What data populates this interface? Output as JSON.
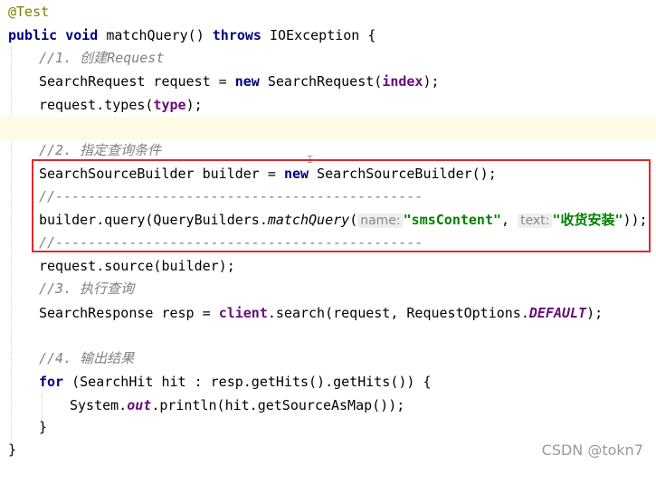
{
  "code": {
    "annotation": "@Test",
    "method_sig": {
      "kw_public": "public",
      "kw_void": "void",
      "name": "matchQuery() ",
      "kw_throws": "throws",
      "rest": " IOException {"
    },
    "comment1": "//1. 创建Request",
    "l3": {
      "a": "SearchRequest request = ",
      "kw_new": "new",
      "b": " SearchRequest(",
      "field": "index",
      "c": ");"
    },
    "l4": {
      "a": "request.types(",
      "field": "type",
      "b": ");"
    },
    "comment2": "//2. 指定查询条件",
    "l7": {
      "a": "SearchSourceBuilder builder = ",
      "kw_new": "new",
      "b": " SearchSourceBuilder();"
    },
    "sep1": "//---------------------------------------------",
    "l9": {
      "a": "builder.query(QueryBuilders.",
      "method": "matchQuery",
      "paren": "(",
      "hint1": "name:",
      "str1": "\"smsContent\"",
      "comma": ", ",
      "hint2": "text:",
      "str2": "\"收货安装\"",
      "end": "));"
    },
    "sep2": "//---------------------------------------------",
    "l11": "request.source(builder);",
    "comment3": "//3. 执行查询",
    "l13": {
      "a": "SearchResponse resp = ",
      "field": "client",
      "b": ".search(request, RequestOptions.",
      "const": "DEFAULT",
      "c": ");"
    },
    "comment4": "//4. 输出结果",
    "l16": {
      "kw_for": "for",
      "a": " (SearchHit hit : resp.getHits().getHits()) {"
    },
    "l17": {
      "a": "System.",
      "field": "out",
      "b": ".println(hit.getSourceAsMap());"
    },
    "close_for": "}",
    "close_method": "}"
  },
  "watermark": "CSDN @tokn7",
  "colors": {
    "keyword": "#000080",
    "comment": "#808080",
    "string": "#008000",
    "field": "#660e7a",
    "highlight_box": "#e02a2a"
  }
}
